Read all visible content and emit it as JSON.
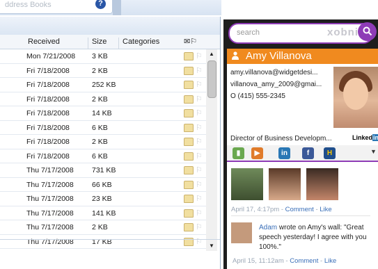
{
  "toolbar": {
    "search_placeholder": "ddress Books",
    "search_button": "?"
  },
  "list": {
    "columns": {
      "received": "Received",
      "size": "Size",
      "categories": "Categories"
    },
    "rows": [
      {
        "date": "Mon 7/21/2008",
        "size": "3 KB"
      },
      {
        "date": "Fri 7/18/2008",
        "size": "2 KB"
      },
      {
        "date": "Fri 7/18/2008",
        "size": "252 KB"
      },
      {
        "date": "Fri 7/18/2008",
        "size": "2 KB"
      },
      {
        "date": "Fri 7/18/2008",
        "size": "14 KB"
      },
      {
        "date": "Fri 7/18/2008",
        "size": "6 KB"
      },
      {
        "date": "Fri 7/18/2008",
        "size": "2 KB"
      },
      {
        "date": "Fri 7/18/2008",
        "size": "6 KB"
      },
      {
        "date": "Thu 7/17/2008",
        "size": "731 KB"
      },
      {
        "date": "Thu 7/17/2008",
        "size": "66 KB"
      },
      {
        "date": "Thu 7/17/2008",
        "size": "23 KB"
      },
      {
        "date": "Thu 7/17/2008",
        "size": "141 KB"
      },
      {
        "date": "Thu 7/17/2008",
        "size": "2 KB"
      },
      {
        "date": "Thu 7/17/2008",
        "size": "17 KB"
      }
    ]
  },
  "xobni": {
    "search_placeholder": "search",
    "logo": "xobni",
    "contact": {
      "name": "Amy Villanova",
      "email1": "amy.villanova@widgetdesi...",
      "email2": "villanova_amy_2009@gmai...",
      "phone": "O (415) 555-2345",
      "title": "Director of Business Developm...",
      "linkedin_label": "Linked",
      "linkedin_badge": "in"
    },
    "social": {
      "icon1": "▮",
      "icon2": "▶",
      "icon3": "in",
      "icon4": "f",
      "icon5": "H",
      "more": "▼"
    },
    "photo_time": "April 17, 4:17pm - ",
    "photo_comment": "Comment",
    "photo_sep": " - ",
    "photo_like": "Like",
    "wall": {
      "author": "Adam",
      "text": " wrote on Amy's wall: \"Great speech yesterday! I agree with you 100%.\"",
      "time": "April 15, 11:12am - ",
      "comment": "Comment",
      "sep": " - ",
      "like": "Like"
    }
  },
  "colors": {
    "accent": "#8e3bb6",
    "namebar": "#f08a1f",
    "link": "#3a6fb8"
  }
}
